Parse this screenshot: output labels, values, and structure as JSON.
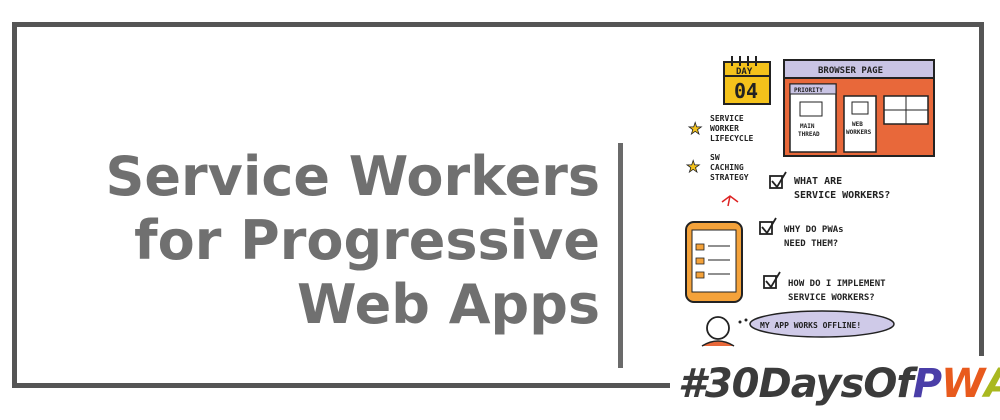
{
  "title": {
    "line1": "Service Workers",
    "line2": "for Progressive",
    "line3": "Web Apps"
  },
  "sketch": {
    "calendar_label": "DAY",
    "calendar_number": "04",
    "browser_title": "BROWSER PAGE",
    "priority_label": "PRIORITY",
    "main_thread_line1": "MAIN",
    "main_thread_line2": "THREAD",
    "web_workers_line1": "WEB",
    "web_workers_line2": "WORKERS",
    "star_items": [
      [
        "SERVICE",
        "WORKER",
        "LIFECYCLE"
      ],
      [
        "SW",
        "CACHING",
        "STRATEGY"
      ]
    ],
    "check_items": [
      [
        "WHAT ARE",
        "SERVICE WORKERS?"
      ],
      [
        "WHY DO PWAs",
        "NEED THEM?"
      ],
      [
        "HOW DO I IMPLEMENT",
        "SERVICE WORKERS?"
      ]
    ],
    "bubble_text": "MY APP WORKS OFFLINE!"
  },
  "hashtag": {
    "prefix": "#30DaysOf",
    "p": "P",
    "w": "W",
    "a": "A"
  },
  "colors": {
    "frame": "#555555",
    "title": "#707070",
    "calendar": "#f4c21b",
    "browser_bg": "#e8683a",
    "browser_header": "#c9c4e4",
    "star": "#f4c21b",
    "phone": "#f4a23a",
    "bubble": "#cfcae8",
    "pwa_p": "#4a3ea8",
    "pwa_w": "#e85a1d",
    "pwa_a": "#a9b820"
  }
}
